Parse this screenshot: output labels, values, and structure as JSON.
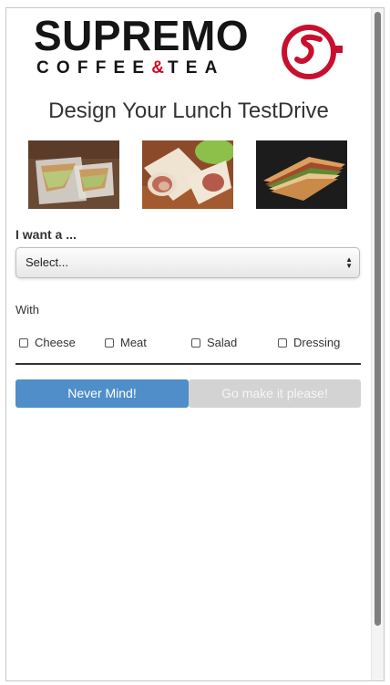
{
  "brand": {
    "name": "SUPREMO",
    "sub_left": "COFFEE",
    "sub_amp": "&",
    "sub_right": "TEA",
    "accent_color": "#c8102e"
  },
  "title": "Design Your Lunch TestDrive",
  "photos": [
    {
      "name": "sandwich-photo"
    },
    {
      "name": "wrap-photo"
    },
    {
      "name": "panini-photo"
    }
  ],
  "form": {
    "want_label": "I want a ...",
    "select_value": "Select...",
    "with_label": "With",
    "options": [
      {
        "label": "Cheese",
        "checked": false
      },
      {
        "label": "Meat",
        "checked": false
      },
      {
        "label": "Salad",
        "checked": false
      },
      {
        "label": "Dressing",
        "checked": false
      }
    ]
  },
  "buttons": {
    "cancel_label": "Never Mind!",
    "submit_label": "Go make it please!",
    "cancel_color": "#4f8ec9",
    "submit_color": "#d3d3d3"
  }
}
